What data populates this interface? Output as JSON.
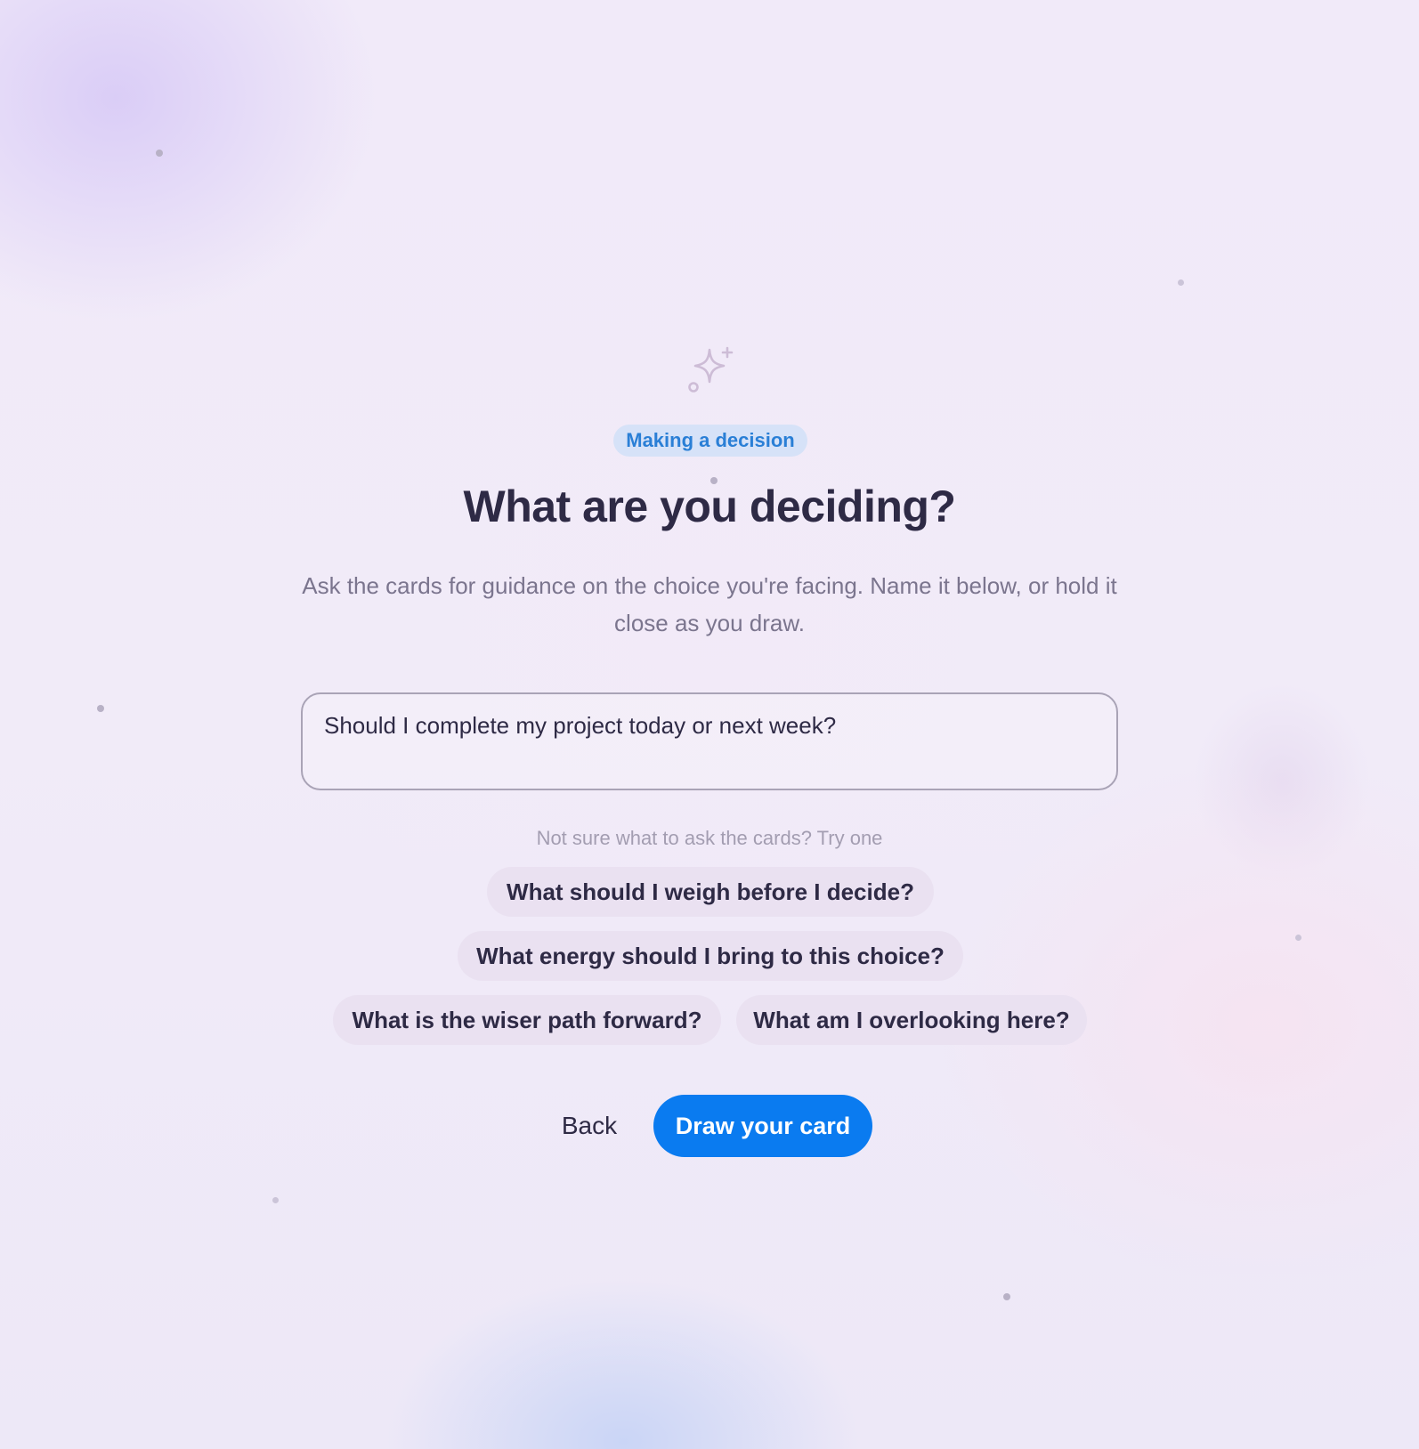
{
  "header": {
    "badge": "Making a decision",
    "title": "What are you deciding?",
    "subtitle": "Ask the cards for guidance on the choice you're facing. Name it below, or hold it close as you draw."
  },
  "question": {
    "value": "Should I complete my project today or next week?"
  },
  "suggestions": {
    "hint": "Not sure what to ask the cards? Try one",
    "items": [
      "What should I weigh before I decide?",
      "What energy should I bring to this choice?",
      "What is the wiser path forward?",
      "What am I overlooking here?"
    ]
  },
  "actions": {
    "back_label": "Back",
    "draw_label": "Draw your card"
  },
  "colors": {
    "accent": "#0a7bf0",
    "badge_text": "#2a7fd6",
    "badge_bg": "#d4e2f8",
    "title": "#2e2a45",
    "sparkle": "#cdbcd6"
  },
  "icons": {
    "header_icon": "sparkle-icon"
  }
}
